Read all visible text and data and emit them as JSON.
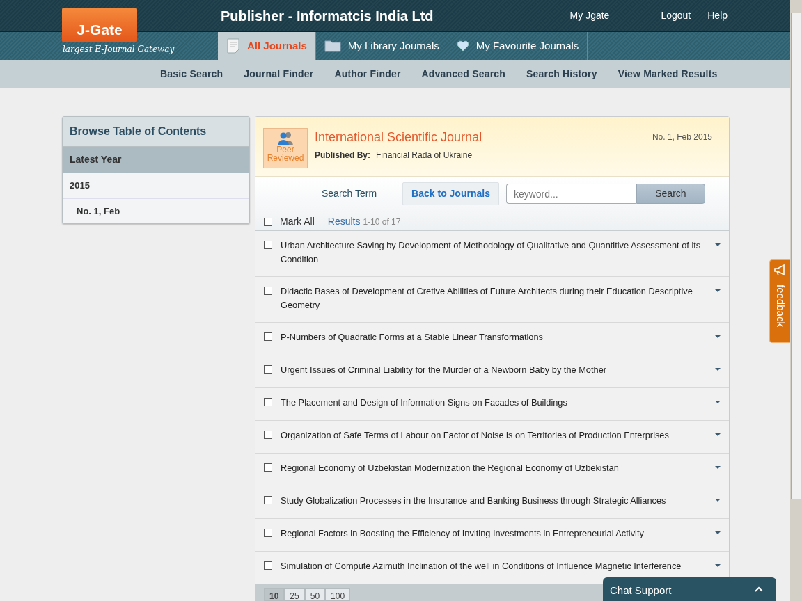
{
  "header": {
    "logo": "J-Gate",
    "tagline": "largest E-Journal Gateway",
    "title": "Publisher - Informatcis India Ltd",
    "links": [
      "My Jgate",
      "Logout",
      "Help"
    ]
  },
  "tabs": [
    {
      "label": "All Journals",
      "selected": true
    },
    {
      "label": "My Library Journals",
      "selected": false
    },
    {
      "label": "My Favourite Journals",
      "selected": false
    }
  ],
  "subnav": [
    "Basic Search",
    "Journal Finder",
    "Author Finder",
    "Advanced Search",
    "Search History",
    "View Marked Results"
  ],
  "sidebar": {
    "title": "Browse Table of Contents",
    "section": "Latest Year",
    "items": [
      {
        "label": "2015",
        "children": [
          {
            "label": "No. 1, Feb"
          }
        ]
      }
    ]
  },
  "journal": {
    "badge": "Peer Reviewed",
    "title": "International Scientific Journal",
    "published_label": "Published By:",
    "publisher": "Financial Rada of Ukraine",
    "issue": "No. 1, Feb 2015"
  },
  "search": {
    "label": "Search Term",
    "back_button": "Back to Journals",
    "placeholder": "keyword...",
    "button": "Search"
  },
  "results": {
    "mark_all": "Mark All",
    "mark_all_checked": false,
    "label": "Results",
    "range": "1-10 of 17"
  },
  "articles": [
    {
      "title": "Urban Architecture Saving by Development of Methodology of Qualitative and Quantitive Assessment of its Condition",
      "checked": false
    },
    {
      "title": "Didactic Bases of Development of Cretive Abilities of Future Architects during their Education Descriptive Geometry",
      "checked": false
    },
    {
      "title": "P-Numbers of Quadratic Forms at a Stable Linear Transformations",
      "checked": false
    },
    {
      "title": "Urgent Issues of Criminal Liability for the Murder of a Newborn Baby by the Mother",
      "checked": false
    },
    {
      "title": "The Placement and Design of Information Signs on Facades of Buildings",
      "checked": false
    },
    {
      "title": "Organization of Safe Terms of Labour on Factor of Noise is on Territories of Production Enterprises",
      "checked": false
    },
    {
      "title": "Regional Economy of Uzbekistan Modernization the Regional Economy of Uzbekistan",
      "checked": false
    },
    {
      "title": "Study Globalization Processes in the Insurance and Banking Business through Strategic Alliances",
      "checked": false
    },
    {
      "title": "Regional Factors in Boosting the Efficiency of Inviting Investments in Entrepreneurial Activity",
      "checked": false
    },
    {
      "title": "Simulation of Compute Azimuth Inclination of the well in Conditions of Influence Magnetic Interference",
      "checked": false
    }
  ],
  "page_sizes": [
    {
      "label": "10",
      "selected": true
    },
    {
      "label": "25",
      "selected": false
    },
    {
      "label": "50",
      "selected": false
    },
    {
      "label": "100",
      "selected": false
    }
  ],
  "feedback": "feedback",
  "chat": {
    "label": "Chat Support",
    "expanded": false
  }
}
